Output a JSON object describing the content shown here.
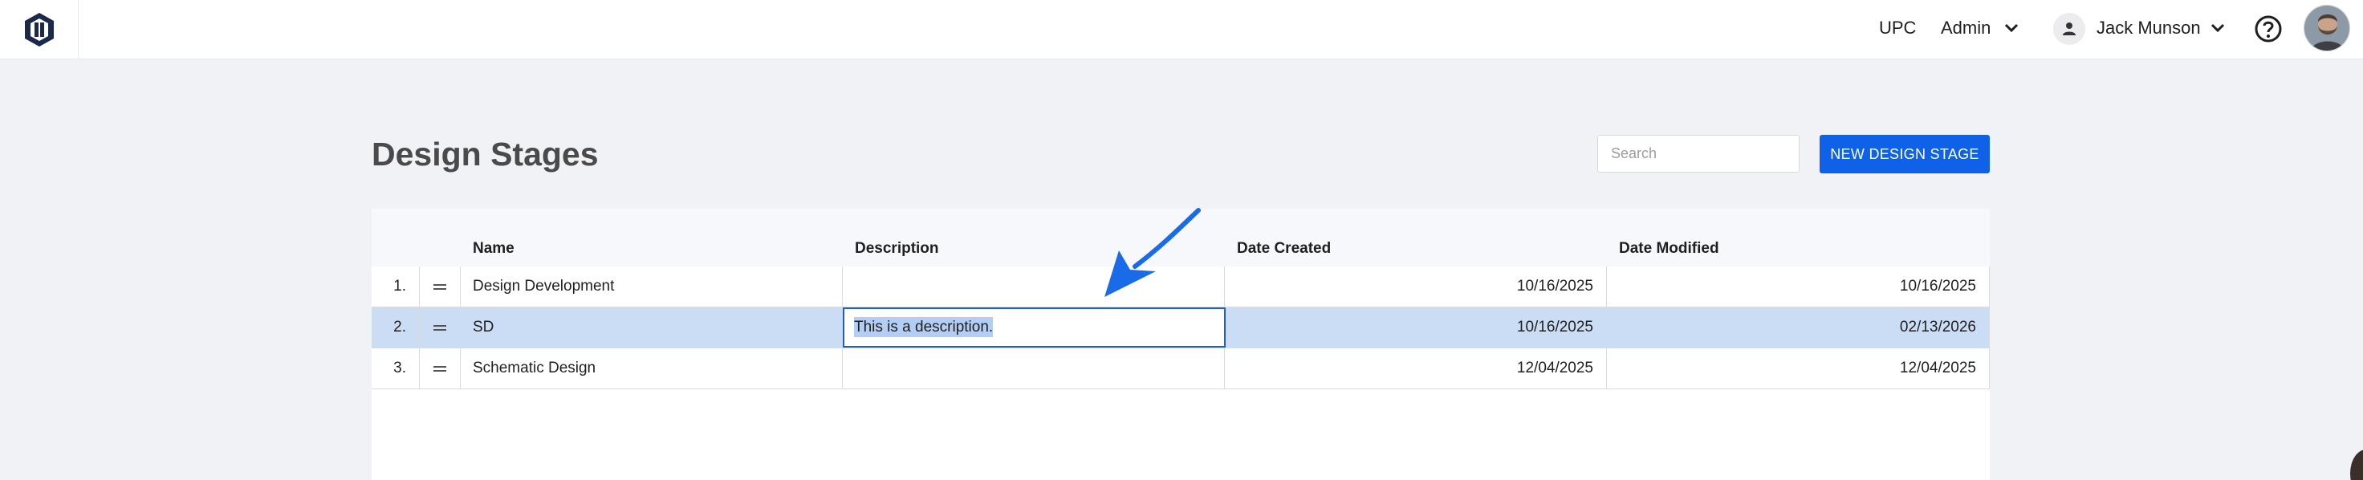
{
  "topbar": {
    "org_label": "UPC",
    "admin_label": "Admin",
    "user_name": "Jack Munson"
  },
  "page": {
    "title": "Design Stages"
  },
  "search": {
    "placeholder": "Search"
  },
  "actions": {
    "new_label": "NEW DESIGN STAGE"
  },
  "table": {
    "columns": {
      "name": "Name",
      "description": "Description",
      "created": "Date Created",
      "modified": "Date Modified"
    },
    "rows": [
      {
        "num": "1.",
        "name": "Design Development",
        "description": "",
        "created": "10/16/2025",
        "modified": "10/16/2025"
      },
      {
        "num": "2.",
        "name": "SD",
        "description": "This is a description.",
        "created": "10/16/2025",
        "modified": "02/13/2026"
      },
      {
        "num": "3.",
        "name": "Schematic Design",
        "description": "",
        "created": "12/04/2025",
        "modified": "12/04/2025"
      }
    ]
  },
  "colors": {
    "accent": "#0f62e8",
    "selected_row": "#cbdcf5",
    "annotation_arrow": "#1a6be8"
  },
  "icons": [
    "app-logo-icon",
    "chevron-down-icon",
    "user-icon",
    "help-icon",
    "drag-handle-icon"
  ]
}
